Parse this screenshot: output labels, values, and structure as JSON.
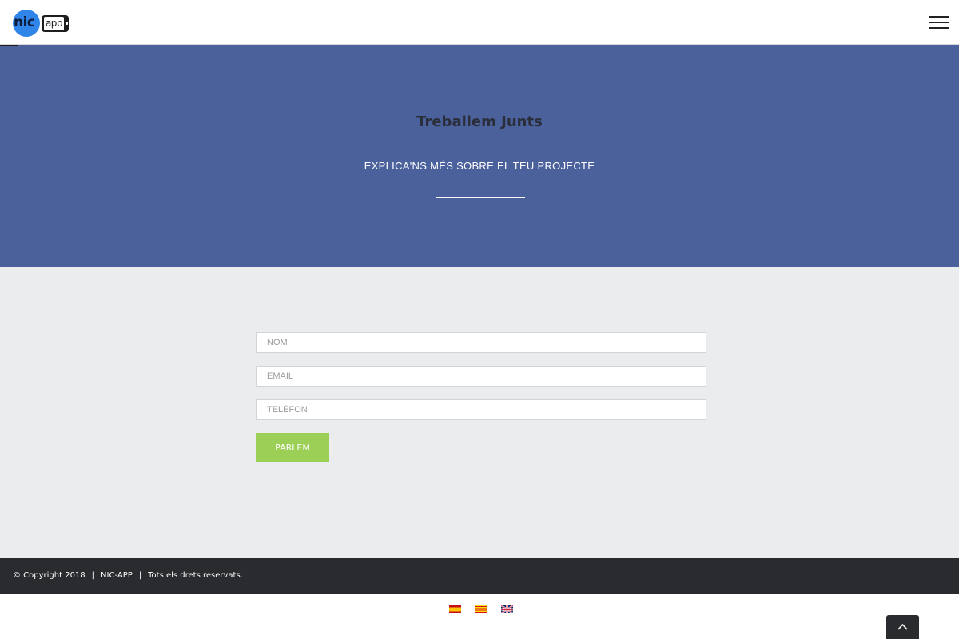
{
  "header": {
    "logo": {
      "circle_text": "nic",
      "phone_text": "app"
    },
    "menu_icon": "hamburger-menu-icon"
  },
  "hero": {
    "title": "Treballem Junts",
    "subtitle": "EXPLICA'NS MÉS SOBRE EL TEU PROJECTE",
    "background": "#4a619b"
  },
  "form": {
    "name_placeholder": "NOM",
    "email_placeholder": "EMAIL",
    "phone_placeholder": "TELÈFON",
    "submit_label": "PARLEM",
    "accent": "#9ccf55"
  },
  "footer": {
    "copyright": "© Copyright 2018",
    "separator": "|",
    "brand": "NIC-APP",
    "rights": "Tots els drets reservats."
  },
  "languages": [
    {
      "code": "es",
      "icon": "spain-flag-icon"
    },
    {
      "code": "ca",
      "icon": "catalonia-flag-icon"
    },
    {
      "code": "en",
      "icon": "uk-flag-icon"
    }
  ],
  "scroll_top_icon": "chevron-up-icon"
}
